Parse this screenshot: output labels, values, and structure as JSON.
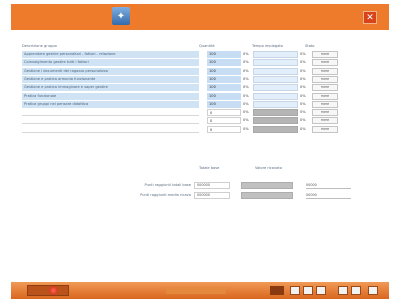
{
  "app": {
    "title_icon": "app-logo-icon",
    "close_icon": "close-icon"
  },
  "headers": {
    "description": "Descrizione gruppo",
    "quantity": "Quantità",
    "weight": "Tempo impiegato",
    "status": "Stato"
  },
  "rows": [
    {
      "label": "Apprendere gestire personalizzi - fattori - relazione",
      "qty": "100",
      "btn": "mere"
    },
    {
      "label": "Coinvolgimento gestire tutti i fattori",
      "qty": "100",
      "btn": "mere"
    },
    {
      "label": "Gestione i documenti del ragazzo personalizzo",
      "qty": "100",
      "btn": "mere"
    },
    {
      "label": "Gestione e pratica armonia funzionante",
      "qty": "100",
      "btn": "mere"
    },
    {
      "label": "Gestione e pratica immaginare e saper gestire",
      "qty": "100",
      "btn": "mere"
    },
    {
      "label": "Pratica funzionale",
      "qty": "100",
      "btn": "mere"
    },
    {
      "label": "Pratica gruppi nel pensare didattica",
      "qty": "100",
      "btn": "mere"
    },
    {
      "label": "",
      "qty": "0",
      "btn": "mere"
    },
    {
      "label": "",
      "qty": "0",
      "btn": "mere"
    },
    {
      "label": "",
      "qty": "0",
      "btn": "mere"
    }
  ],
  "pct_symbol": "0%",
  "summary": {
    "header_left": "Totale base",
    "header_right": "Valore ricavato",
    "rows": [
      {
        "label": "Punti raggiunti totali base",
        "value": "000000",
        "value2": "00000"
      },
      {
        "label": "Punti raggiunti media ricavo",
        "value": "000000",
        "value2": "00000"
      }
    ]
  },
  "taskbar": {
    "record_icon": "record-icon",
    "pager_icon": "pager-icon"
  },
  "colors": {
    "titlebar": "#ee7b2c",
    "row_fill": "#cfe3f5",
    "close": "#d8431a"
  }
}
